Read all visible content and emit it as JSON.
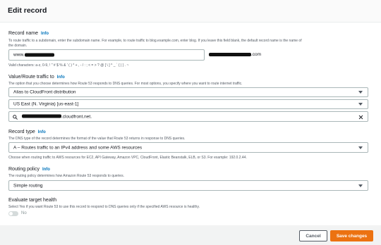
{
  "header": {
    "title": "Edit record"
  },
  "record_name": {
    "label": "Record name",
    "info": "Info",
    "description_line1": "To route traffic to a subdomain, enter the subdomain name. For example, to route traffic to blog.example.com, enter blog. If you leave this field blank, the default record name is the name of",
    "description_line2": "the domain.",
    "value_prefix": "www.",
    "domain_suffix": ".com",
    "valid_chars": "Valid characters: a-z, 0-9, ! \" # $ % & ' ( ) * + , - / : ; < = > ? @ [ \\ ] ^ _ ` { | } . ~"
  },
  "route_traffic": {
    "label": "Value/Route traffic to",
    "info": "Info",
    "description": "The option that you choose determines how Route 53 responds to DNS queries. For most options, you specify where you want to route internet traffic.",
    "endpoint_select": "Alias to CloudFront distribution",
    "region_select": "US East (N. Virginia) [us-east-1]",
    "distribution_suffix": ".cloudfront.net.",
    "search_icon": "search-icon",
    "clear_icon": "close-icon"
  },
  "record_type": {
    "label": "Record type",
    "info": "Info",
    "description": "The DNS type of the record determines the format of the value that Route 53 returns in response to DNS queries.",
    "selected": "A – Routes traffic to an IPv4 address and some AWS resources",
    "hint": "Choose when routing traffic to AWS resources for EC2, API Gateway, Amazon VPC, CloudFront, Elastic Beanstalk, ELB, or S3. For example: 192.0.2.44."
  },
  "routing_policy": {
    "label": "Routing policy",
    "info": "Info",
    "description": "The routing policy determines how Amazon Route 53 responds to queries.",
    "selected": "Simple routing"
  },
  "evaluate_health": {
    "label": "Evaluate target health",
    "description": "Select Yes if you want Route 53 to use this record to respond to DNS queries only if the specified AWS resource is healthy.",
    "toggle_label": "No"
  },
  "footer": {
    "cancel": "Cancel",
    "save": "Save changes"
  },
  "colors": {
    "accent": "#ec7211",
    "link": "#0073bb"
  }
}
